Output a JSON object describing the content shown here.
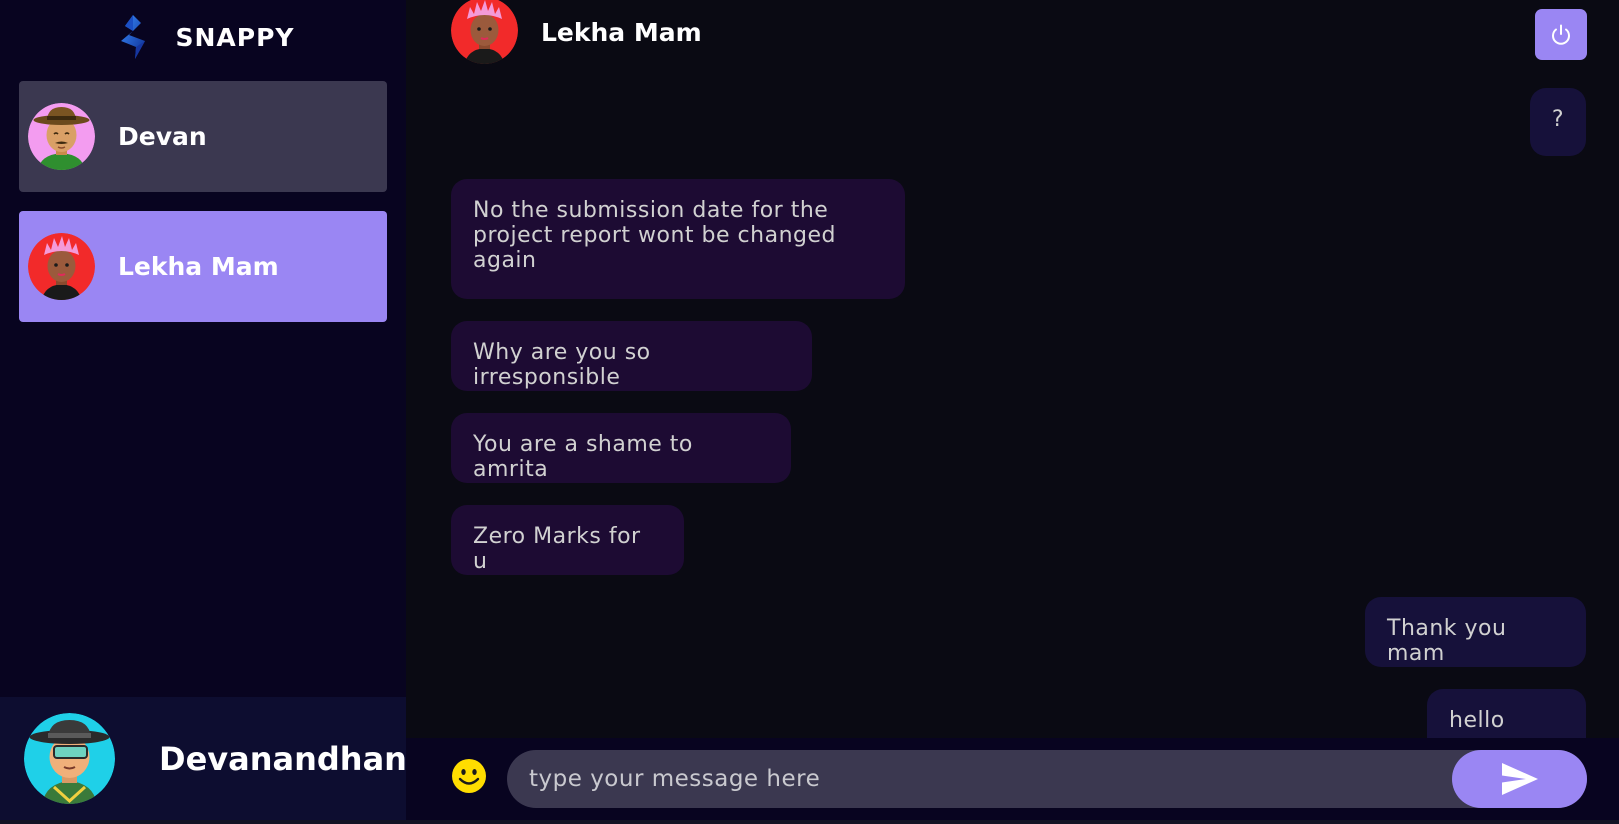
{
  "app": {
    "brand": "snappy",
    "logo_icon": "snappy-logo-icon"
  },
  "colors": {
    "accent": "#9a86f3",
    "sidebar_bg": "#080420",
    "chat_bg": "#0a0a13",
    "contact_bg": "#3b3850",
    "bubble_bg": "#1e0c36",
    "emoji_yellow": "#ffdd00"
  },
  "contacts": [
    {
      "name": "Devan",
      "avatar_icon": "cowboy-avatar-icon",
      "selected": false
    },
    {
      "name": "Lekha Mam",
      "avatar_icon": "pink-hair-avatar-icon",
      "selected": true
    }
  ],
  "current_user": {
    "name": "Devanandhan",
    "avatar_icon": "hat-avatar-icon"
  },
  "chat": {
    "contact_name": "Lekha Mam",
    "logout_icon": "power-icon",
    "messages": [
      {
        "direction": "sent",
        "text": "?"
      },
      {
        "direction": "received",
        "text": "No the submission date for the project report wont be changed again"
      },
      {
        "direction": "received",
        "text": "Why are you so irresponsible"
      },
      {
        "direction": "received",
        "text": "You are a shame to amrita"
      },
      {
        "direction": "received",
        "text": "Zero Marks for u"
      },
      {
        "direction": "sent",
        "text": "Thank you mam"
      },
      {
        "direction": "sent",
        "text": "hello mam"
      }
    ]
  },
  "input": {
    "placeholder": "type your message here",
    "value": "",
    "emoji_icon": "smiley-icon",
    "send_icon": "send-icon"
  }
}
